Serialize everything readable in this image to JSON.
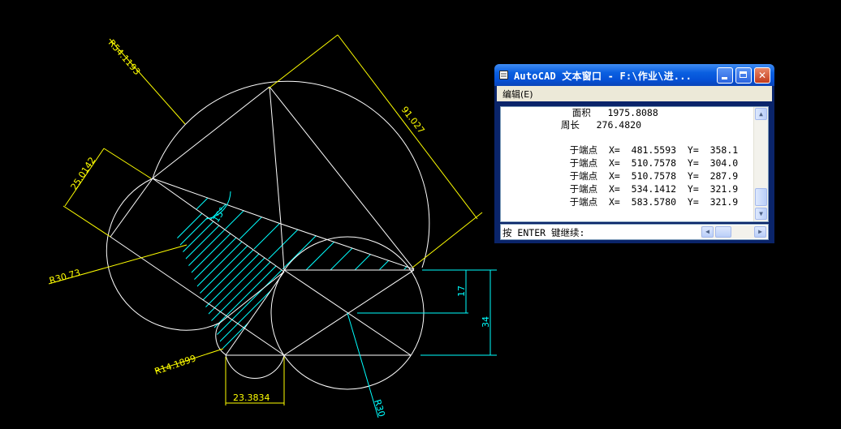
{
  "drawing": {
    "dimensions": {
      "radius_top_arc": "R54.1193",
      "aligned_right": "91.027",
      "aligned_left": "25.0142",
      "radius_left_circle": "R30.73",
      "angle_hatch": "15°",
      "vertical_small": "17",
      "vertical_large": "34",
      "radius_bottom_left": "R14.1899",
      "horizontal_bottom": "23.3834",
      "radius_bottom_right": "R30"
    },
    "colors": {
      "geometry": "#ffffff",
      "dimension": "#ffff00",
      "hatch": "#00ffff"
    }
  },
  "text_window": {
    "title": "AutoCAD 文本窗口 - F:\\作业\\进...",
    "buttons": {
      "minimize": "minimize",
      "maximize": "maximize",
      "close": "✕"
    },
    "menu": {
      "edit": "编辑(E)"
    },
    "lines": [
      "    面积   1975.8088",
      "  周长   276.4820",
      "",
      "     于端点  X=  481.5593  Y=  358.1",
      "     于端点  X=  510.7578  Y=  304.0",
      "     于端点  X=  510.7578  Y=  287.9",
      "     于端点  X=  534.1412  Y=  321.9",
      "     于端点  X=  583.5780  Y=  321.9"
    ],
    "prompt": "按 ENTER 键继续:",
    "scroll": {
      "up": "▲",
      "down": "▼",
      "left": "◀",
      "right": "▶"
    }
  }
}
